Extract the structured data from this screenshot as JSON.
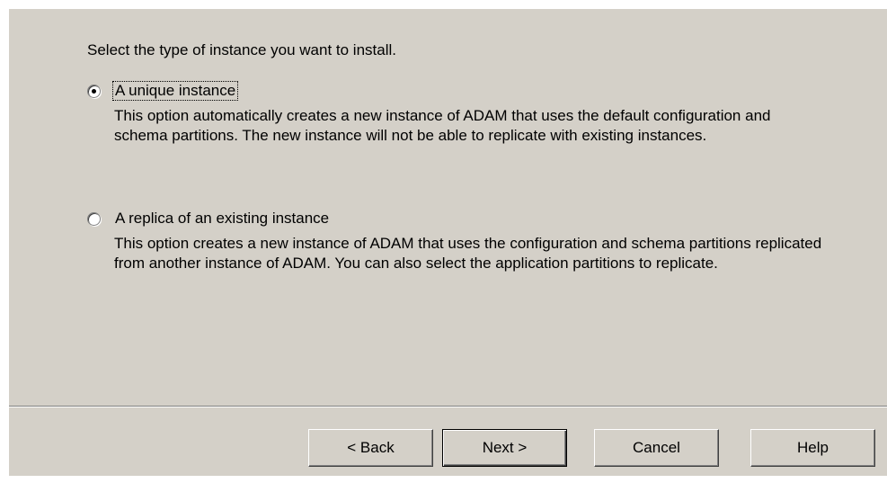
{
  "prompt": "Select the type of instance you want to install.",
  "options": [
    {
      "label": "A unique instance",
      "description": "This option automatically creates a new instance of ADAM that uses the default configuration and schema partitions. The new instance will not be able to replicate with existing instances.",
      "selected": true
    },
    {
      "label": "A replica of an existing instance",
      "description": "This option creates a new instance of ADAM that uses the configuration and schema partitions replicated from another instance of ADAM. You can also select the application partitions to replicate.",
      "selected": false
    }
  ],
  "buttons": {
    "back": "< Back",
    "next": "Next >",
    "cancel": "Cancel",
    "help": "Help"
  }
}
